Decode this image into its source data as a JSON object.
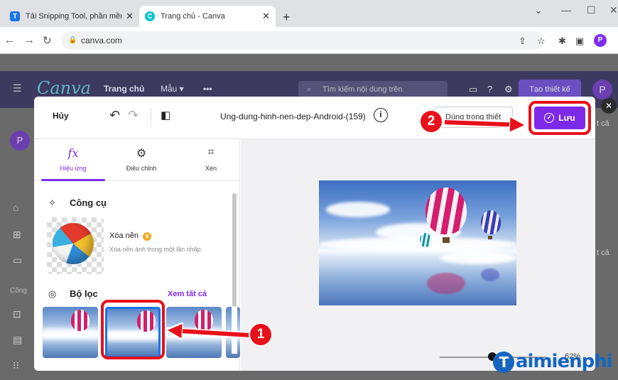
{
  "browser": {
    "tabs": [
      {
        "label": "Tải Snipping Tool, phần mềm chụ",
        "favicon": "T"
      },
      {
        "label": "Trang chủ - Canva",
        "favicon": "C"
      }
    ],
    "new_tab": "+",
    "url": "canva.com",
    "profile_initial": "P"
  },
  "canva": {
    "logo": "Canva",
    "nav": [
      "Trang chủ",
      "Mẫu ▾",
      "•••"
    ],
    "search_placeholder": "Tìm kiếm nội dung trên",
    "create_button": "Tạo thiết kế",
    "avatar": "P",
    "side_right_labels": [
      "t cả",
      "t cả"
    ],
    "side_left_label": "Công"
  },
  "editor": {
    "cancel": "Hủy",
    "filename": "Ung-dung-hinh-nen-dep-Android-(159)",
    "use_in_design": "Dùng trong thiết",
    "save": "Lưu",
    "tabs": [
      {
        "icon": "fx",
        "label": "Hiệu ứng"
      },
      {
        "icon": "⚙",
        "label": "Điều chỉnh"
      },
      {
        "icon": "⌗",
        "label": "Xén"
      }
    ],
    "tools_title": "Công cụ",
    "remove_bg_title": "Xóa nền",
    "remove_bg_desc": "Xóa nền ảnh trong một lần nhấp.",
    "filters_title": "Bộ lọc",
    "see_all": "Xem tất cả",
    "zoom": "62%"
  },
  "annotations": {
    "step1": "1",
    "step2": "2"
  },
  "watermark": "aimienphi",
  "watermark_t": "T",
  "colors": {
    "accent": "#7d2ae8",
    "annotation": "#e8101a"
  }
}
